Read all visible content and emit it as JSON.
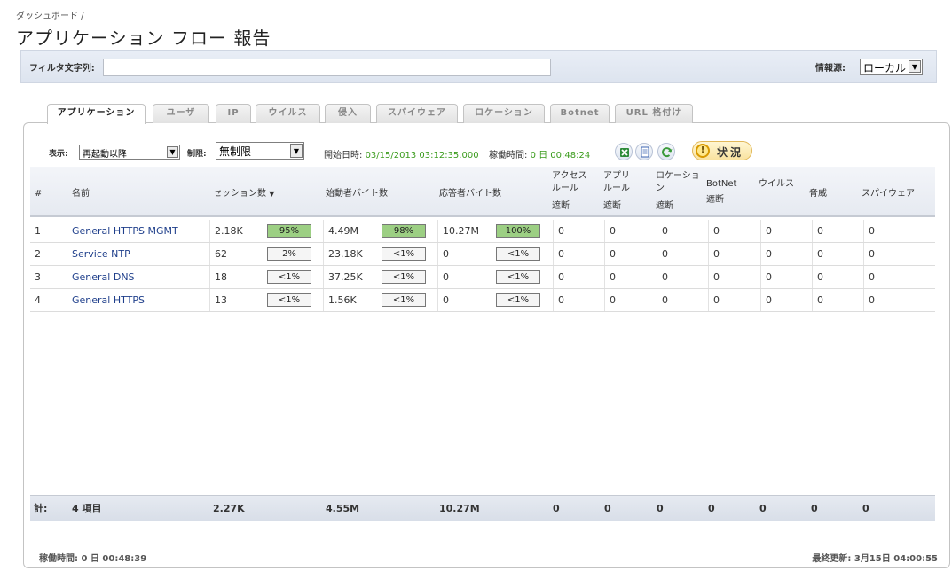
{
  "breadcrumb": "ダッシュボード /",
  "title": "アプリケーション フロー 報告",
  "filter": {
    "label": "フィルタ文字列:",
    "value": "",
    "source_label": "情報源:",
    "source_value": "ローカル"
  },
  "tabs": [
    "アプリケーション",
    "ユーザ",
    "IP",
    "ウイルス",
    "侵入",
    "スパイウェア",
    "ロケーション",
    "Botnet",
    "URL 格付け"
  ],
  "controls": {
    "display_label": "表示:",
    "display_value": "再起動以降",
    "limit_label": "制限:",
    "limit_value": "無制限",
    "start_label": "開始日時:",
    "start_value": "03/15/2013 03:12:35.000",
    "uptime_label": "稼働時間:",
    "uptime_value": "0 日 00:48:24",
    "status_label": "状況",
    "icons": [
      "excel-export-icon",
      "document-icon",
      "refresh-icon",
      "warning-icon"
    ]
  },
  "columns": {
    "num": "#",
    "name": "名前",
    "sessions": "セッション数",
    "initiator": "始動者バイト数",
    "responder": "応答者バイト数",
    "access": [
      "アクセス",
      "ルール",
      "遮断"
    ],
    "app": [
      "アプリ",
      "ルール",
      "遮断"
    ],
    "location": [
      "ロケーショ",
      "ン",
      "遮断"
    ],
    "botnet": [
      "BotNet",
      "遮断"
    ],
    "virus": "ウイルス",
    "threat": "脅威",
    "spyware": "スパイウェア"
  },
  "rows": [
    {
      "num": "1",
      "name": "General HTTPS MGMT",
      "sessions": "2.18K",
      "sessions_pct": "95%",
      "initiator": "4.49M",
      "initiator_pct": "98%",
      "responder": "10.27M",
      "responder_pct": "100%",
      "access": "0",
      "app": "0",
      "location": "0",
      "botnet": "0",
      "virus": "0",
      "threat": "0",
      "spyware": "0"
    },
    {
      "num": "2",
      "name": "Service NTP",
      "sessions": "62",
      "sessions_pct": "2%",
      "initiator": "23.18K",
      "initiator_pct": "<1%",
      "responder": "0",
      "responder_pct": "<1%",
      "access": "0",
      "app": "0",
      "location": "0",
      "botnet": "0",
      "virus": "0",
      "threat": "0",
      "spyware": "0"
    },
    {
      "num": "3",
      "name": "General DNS",
      "sessions": "18",
      "sessions_pct": "<1%",
      "initiator": "37.25K",
      "initiator_pct": "<1%",
      "responder": "0",
      "responder_pct": "<1%",
      "access": "0",
      "app": "0",
      "location": "0",
      "botnet": "0",
      "virus": "0",
      "threat": "0",
      "spyware": "0"
    },
    {
      "num": "4",
      "name": "General HTTPS",
      "sessions": "13",
      "sessions_pct": "<1%",
      "initiator": "1.56K",
      "initiator_pct": "<1%",
      "responder": "0",
      "responder_pct": "<1%",
      "access": "0",
      "app": "0",
      "location": "0",
      "botnet": "0",
      "virus": "0",
      "threat": "0",
      "spyware": "0"
    }
  ],
  "totals": {
    "label": "計:",
    "count": "4 項目",
    "sessions": "2.27K",
    "initiator": "4.55M",
    "responder": "10.27M",
    "access": "0",
    "app": "0",
    "location": "0",
    "botnet": "0",
    "virus": "0",
    "threat": "0",
    "spyware": "0"
  },
  "footer": {
    "uptime": "稼働時間: 0 日 00:48:39",
    "last_update": "最終更新: 3月15日 04:00:55"
  }
}
